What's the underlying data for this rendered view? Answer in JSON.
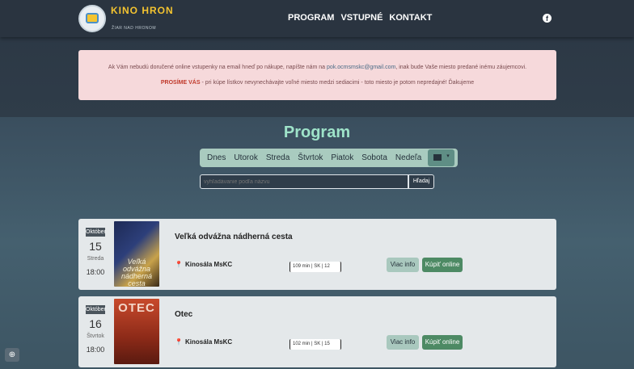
{
  "header": {
    "logo_text": "KINO HRON",
    "logo_sub": "ŽIAR NAD HRONOM",
    "nav": [
      "PROGRAM",
      "VSTUPNÉ",
      "KONTAKT"
    ],
    "social_icon": "facebook-icon"
  },
  "notice": {
    "line1_before": "Ak Vám nebudú doručené online vstupenky na email hneď po nákupe, napíšte nám na ",
    "line1_email": "pok.ocmsmskc@gmail.com",
    "line1_after": ", inak bude Vaše miesto predané inému záujemcovi.",
    "line2_emph": "PROSÍME VÁS",
    "line2_rest": " - pri kúpe lístkov nevynechávajte voľné miesto medzi sediacimi - toto miesto je potom nepredajné! Ďakujeme"
  },
  "program": {
    "title": "Program",
    "days": [
      "Dnes",
      "Utorok",
      "Streda",
      "Štvrtok",
      "Piatok",
      "Sobota",
      "Nedeľa"
    ],
    "calendar_icon": "calendar-icon",
    "search_placeholder": "vyhľadávanie podľa názvu",
    "search_button": "Hľadaj"
  },
  "screenings": [
    {
      "month": "Október",
      "day": "15",
      "weekday": "Streda",
      "time": "18:00",
      "poster_text": "Veľká odvážna nádherná cesta",
      "title": "Veľká odvážna nádherná cesta",
      "venue": "Kinosála MsKC",
      "bar_text": "109 min  |  SK  |  12",
      "info_label": "Viac info",
      "buy_label": "Kúpiť online"
    },
    {
      "month": "Október",
      "day": "16",
      "weekday": "Štvrtok",
      "time": "18:00",
      "poster_text": "OTEC",
      "title": "Otec",
      "venue": "Kinosála MsKC",
      "bar_text": "102 min  |  SK  |  15",
      "info_label": "Viac info",
      "buy_label": "Kúpiť online"
    }
  ],
  "colors": {
    "accent": "#9ee3c9",
    "buy_button": "#4d8a64",
    "info_button": "#a9c8be",
    "notice_bg": "#f6d9db",
    "notice_emph": "#c0392b"
  }
}
